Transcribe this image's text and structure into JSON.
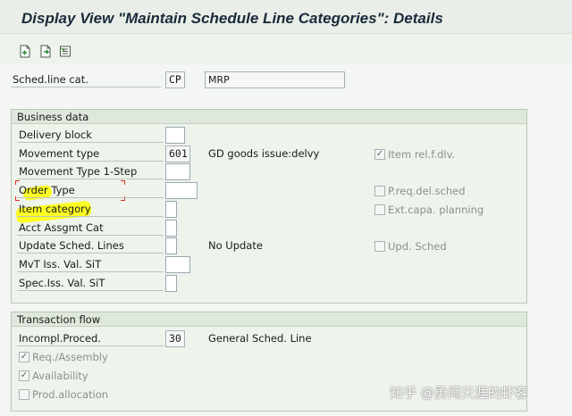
{
  "window": {
    "title": "Display View \"Maintain Schedule Line Categories\": Details"
  },
  "toolbar": {
    "icons": [
      "new-entries-icon",
      "copy-as-icon",
      "delete-icon"
    ]
  },
  "header": {
    "sched_line_cat_label": "Sched.line cat.",
    "sched_line_cat_value": "CP",
    "sched_line_cat_desc": "MRP"
  },
  "business_data": {
    "title": "Business data",
    "delivery_block_label": "Delivery block",
    "delivery_block_value": "",
    "movement_type_label": "Movement type",
    "movement_type_value": "601",
    "movement_type_desc": "GD goods issue:delvy",
    "movement_type_1step_label": "Movement Type 1-Step",
    "order_type_label": "Order Type",
    "item_category_label": "Item category",
    "acct_assgmt_cat_label": "Acct Assgmt Cat",
    "update_sched_lines_label": "Update Sched. Lines",
    "update_sched_lines_desc": "No Update",
    "mvt_iss_val_sit_label": "MvT Iss. Val. SiT",
    "spec_iss_val_sit_label": "Spec.Iss. Val. SiT",
    "item_rel_f_dlv": {
      "label": "Item rel.f.dlv.",
      "checked": true
    },
    "p_req_del_sched": {
      "label": "P.req.del.sched",
      "checked": false
    },
    "ext_capa_planning": {
      "label": "Ext.capa. planning",
      "checked": false
    },
    "upd_sched": {
      "label": "Upd. Sched",
      "checked": false
    }
  },
  "transaction_flow": {
    "title": "Transaction flow",
    "incompl_proced_label": "Incompl.Proced.",
    "incompl_proced_value": "30",
    "incompl_proced_desc": "General Sched. Line",
    "req_assembly": {
      "label": "Req./Assembly",
      "checked": true
    },
    "availability": {
      "label": "Availability",
      "checked": true
    },
    "prod_allocation": {
      "label": "Prod.allocation",
      "checked": false
    }
  },
  "watermark": "知乎 @勇闯天涯的虾客",
  "colors": {
    "highlight": "#ffff00",
    "annotation_red": "#e0301e"
  }
}
